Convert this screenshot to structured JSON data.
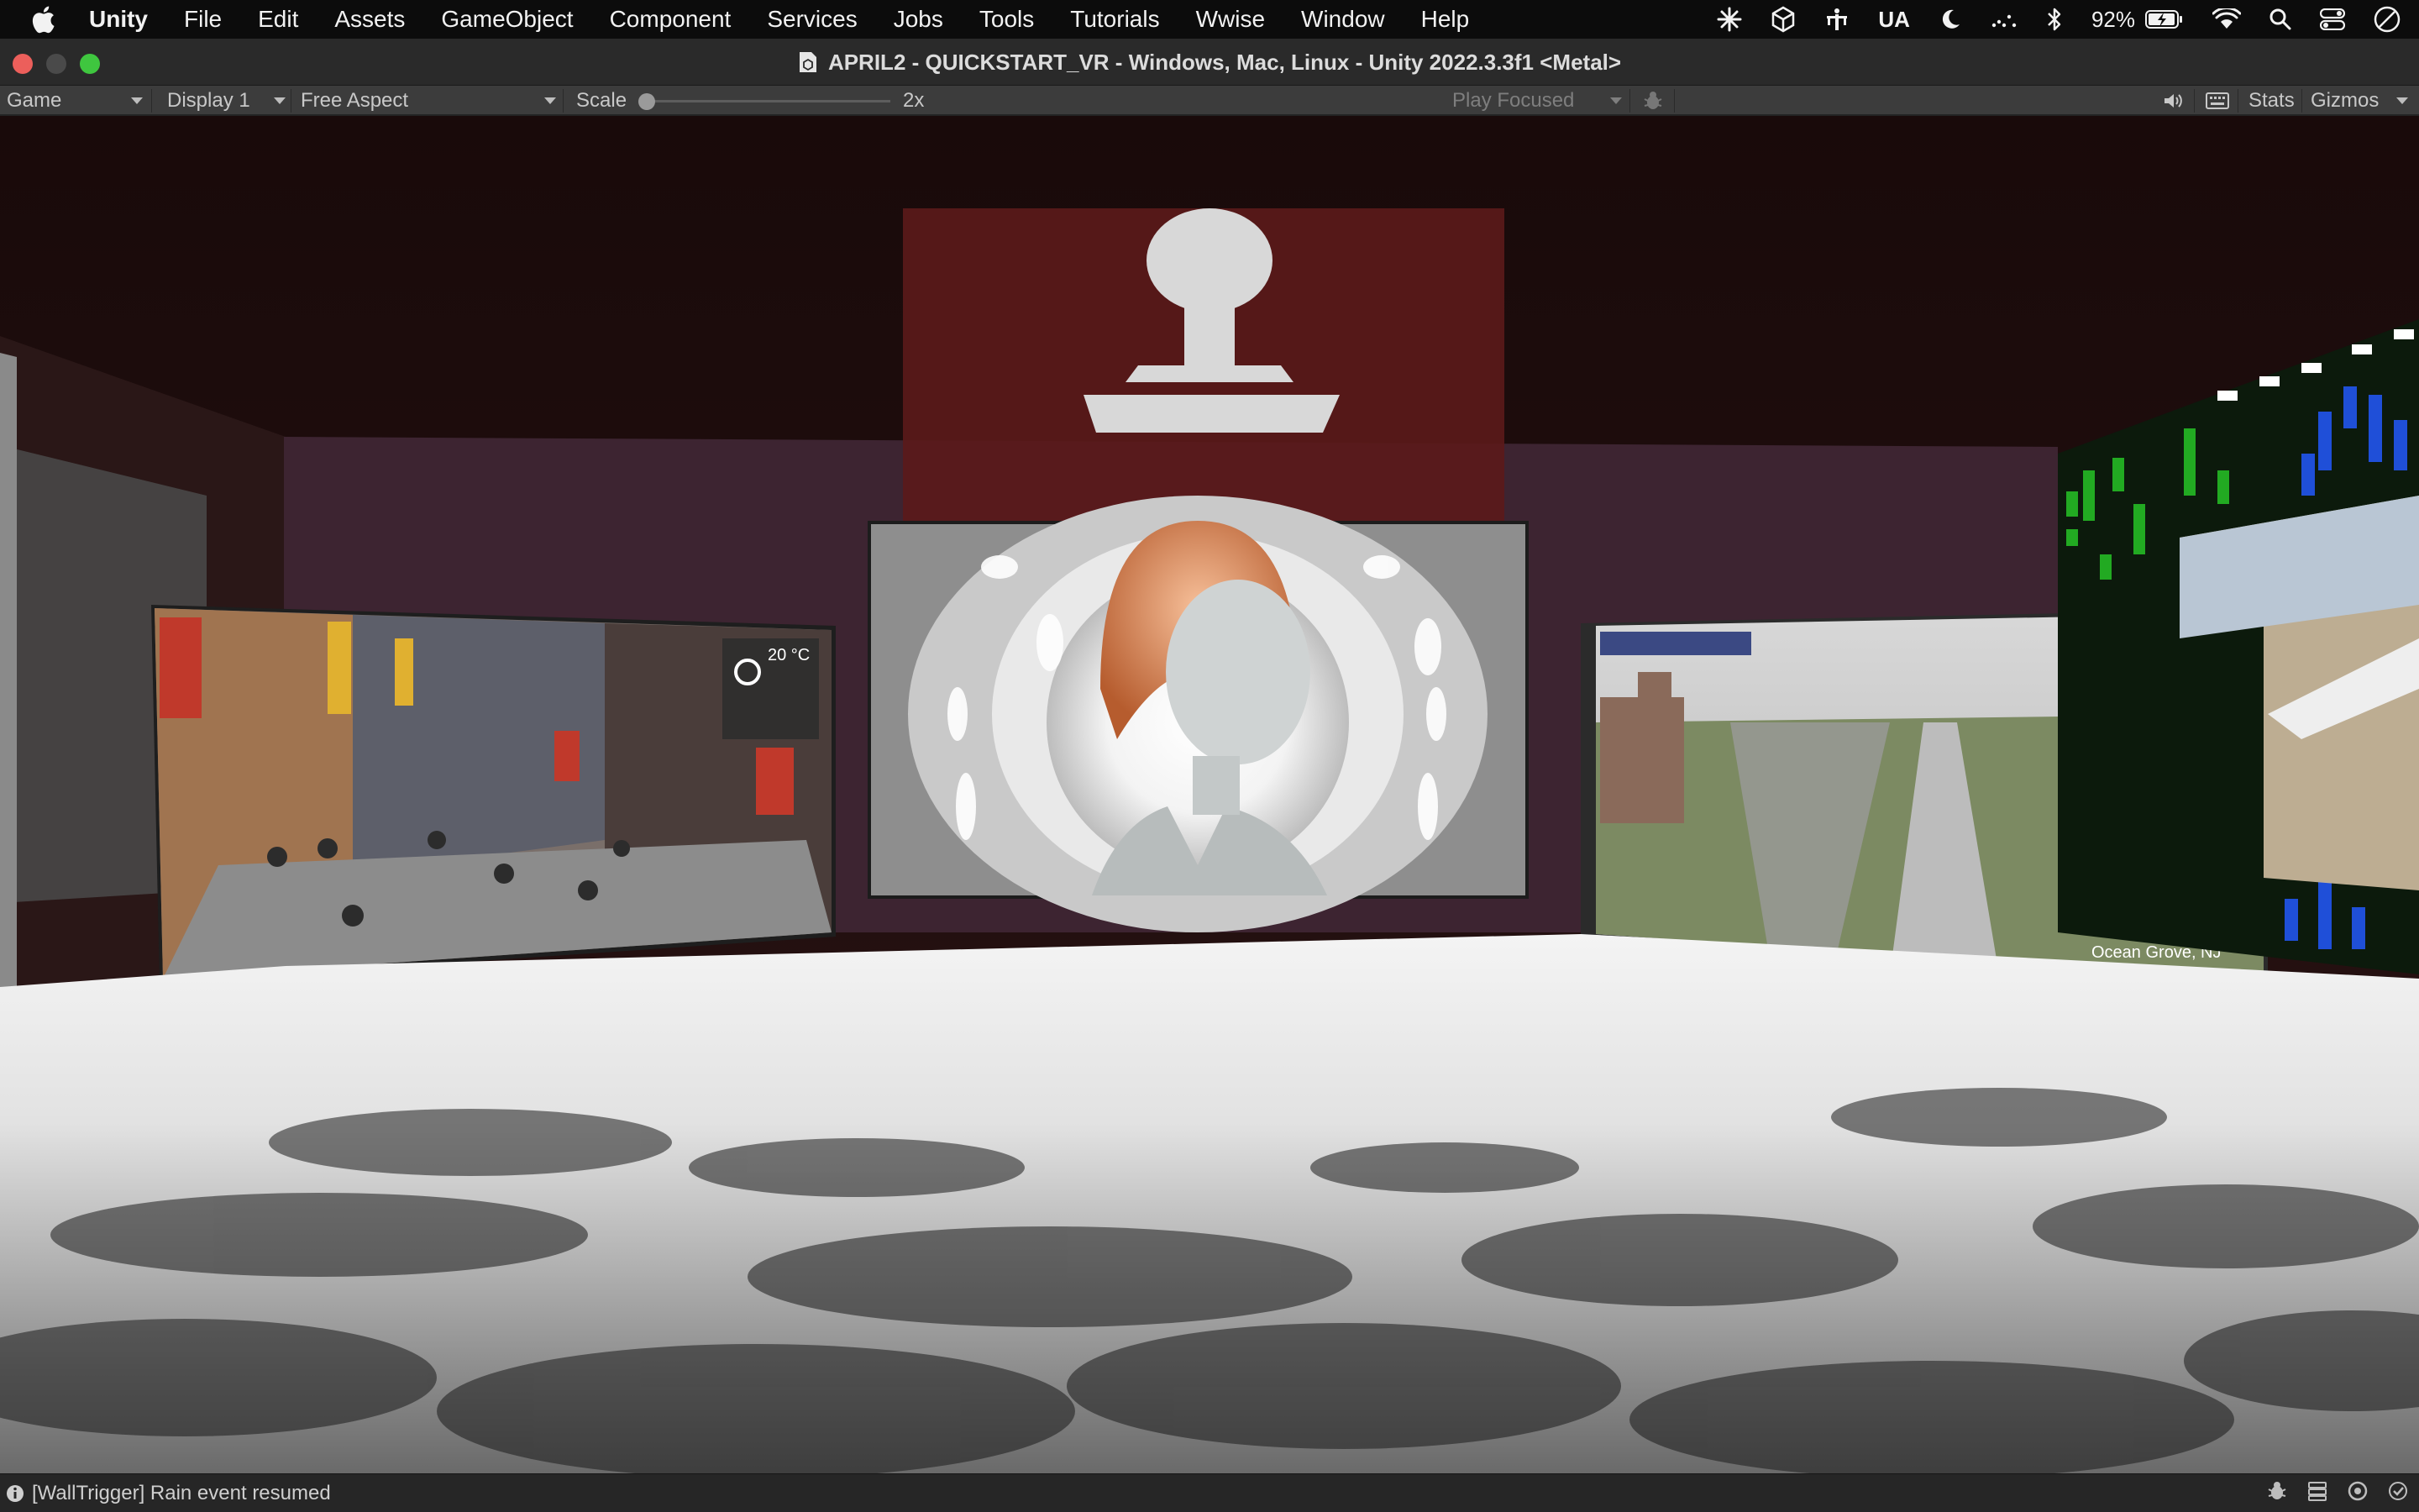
{
  "menubar": {
    "items": [
      "Unity",
      "File",
      "Edit",
      "Assets",
      "GameObject",
      "Component",
      "Services",
      "Jobs",
      "Tools",
      "Tutorials",
      "Wwise",
      "Window",
      "Help"
    ],
    "input_source": "UA",
    "battery": "92%"
  },
  "window": {
    "title": "APRIL2 - QUICKSTART_VR - Windows, Mac, Linux - Unity 2022.3.3f1 <Metal>"
  },
  "toolbar": {
    "view_mode": "Game",
    "display": "Display 1",
    "aspect": "Free Aspect",
    "scale_label": "Scale",
    "scale_value": "2x",
    "play_mode": "Play Focused",
    "stats": "Stats",
    "gizmos": "Gizmos"
  },
  "scene": {
    "left_screen": {
      "weather": "20 °C"
    },
    "right_screen": {
      "location": "Ocean Grove, NJ"
    }
  },
  "status": {
    "message": "[WallTrigger] Rain event resumed"
  },
  "colors": {
    "menubar_bg": "#0c0c0c",
    "titlebar_bg": "#2a2a2a",
    "toolbar_bg": "#3c3c3c",
    "status_bg": "#262626",
    "close": "#ec5f5b",
    "maximize": "#3fc63f"
  }
}
